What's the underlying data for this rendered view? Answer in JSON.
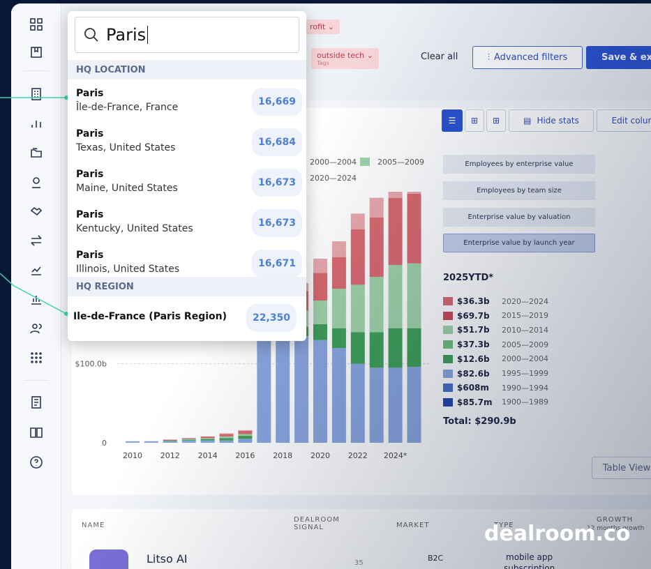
{
  "filters": {
    "chip_profit": "rofit",
    "chip_tech": "outside tech",
    "chip_tech_sub": "Tags",
    "clear_all": "Clear all",
    "advanced_filters": "Advanced filters",
    "save_export": "Save & expo"
  },
  "toolbar": {
    "hide_stats": "Hide stats",
    "edit_columns": "Edit colur"
  },
  "chart_legend_top": [
    "2000—2004",
    "2005—2009",
    "2020—2024"
  ],
  "stat_buttons": [
    "Employees by enterprise value",
    "Employees by team size",
    "Enterprise value by valuation",
    "Enterprise value by launch year"
  ],
  "stats": {
    "heading": "2025YTD*",
    "rows": [
      {
        "value": "$36.3b",
        "label": "2020—2024",
        "color": "#d9696f"
      },
      {
        "value": "$69.7b",
        "label": "2015—2019",
        "color": "#c94a56"
      },
      {
        "value": "$51.7b",
        "label": "2010—2014",
        "color": "#9fd3a8"
      },
      {
        "value": "$37.3b",
        "label": "2005—2009",
        "color": "#6fbf7f"
      },
      {
        "value": "$12.6b",
        "label": "2000—2004",
        "color": "#3f9f58"
      },
      {
        "value": "$82.6b",
        "label": "1995—1999",
        "color": "#8aa6de"
      },
      {
        "value": "$608m",
        "label": "1990—1994",
        "color": "#4a6fc9"
      },
      {
        "value": "$85.7m",
        "label": "1900—1989",
        "color": "#2446b0"
      }
    ],
    "total": "Total: $290.9b"
  },
  "chart_data": {
    "type": "bar",
    "categories": [
      "2010",
      "2011",
      "2012",
      "2013",
      "2014",
      "2015",
      "2016",
      "2017",
      "2018",
      "2019",
      "2020",
      "2021",
      "2022",
      "2023",
      "2024",
      "2025"
    ],
    "x_tick_labels": [
      "2010",
      "2012",
      "2014",
      "2016",
      "2018",
      "2020",
      "2022",
      "2024*"
    ],
    "y_tick_labels": [
      "0",
      "$100.0b"
    ],
    "series": [
      {
        "values": [
          2,
          2,
          2,
          3,
          3,
          3,
          5,
          160,
          140,
          135,
          130,
          120,
          100,
          95,
          95,
          96
        ]
      },
      {
        "values": [
          0,
          0,
          1,
          1,
          2,
          3,
          4,
          6,
          8,
          12,
          20,
          25,
          40,
          45,
          50,
          49
        ]
      },
      {
        "values": [
          0,
          0,
          0,
          1,
          1,
          2,
          2,
          10,
          14,
          20,
          30,
          50,
          60,
          70,
          80,
          82
        ]
      },
      {
        "values": [
          0,
          0,
          1,
          1,
          2,
          3,
          4,
          20,
          20,
          25,
          35,
          40,
          70,
          75,
          85,
          88
        ]
      },
      {
        "values": [
          0,
          0,
          0,
          0,
          0,
          1,
          1,
          5,
          8,
          10,
          18,
          20,
          20,
          25,
          30,
          35
        ]
      }
    ],
    "series_colors": [
      "#8aa6de",
      "#3f9f58",
      "#9fd3a8",
      "#d9696f",
      "#e8a9ad"
    ],
    "ylim": [
      0,
      300
    ]
  },
  "table": {
    "name": "NAME",
    "signal": "DEALROOM SIGNAL",
    "market": "MARKET",
    "type": "TYPE",
    "growth": "GROWTH",
    "growth_sub": "12 months growth",
    "table_view": "Table View",
    "row1_name": "Litso AI",
    "row1_market": "B2C",
    "row1_type": "mobile app",
    "row1_type2": "subscription",
    "row1_signal": "35"
  },
  "search": {
    "query": "Paris",
    "section_location": "HQ LOCATION",
    "section_region": "HQ REGION",
    "locations": [
      {
        "name": "Paris",
        "sub": "Île-de-France, France",
        "count": "16,669"
      },
      {
        "name": "Paris",
        "sub": "Texas, United States",
        "count": "16,684"
      },
      {
        "name": "Paris",
        "sub": "Maine, United States",
        "count": "16,673"
      },
      {
        "name": "Paris",
        "sub": "Kentucky, United States",
        "count": "16,673"
      },
      {
        "name": "Paris",
        "sub": "Illinois, United States",
        "count": "16,671"
      }
    ],
    "region": {
      "name": "Ile-de-France (Paris Region)",
      "count": "22,350"
    }
  },
  "brand": "dealroom.co"
}
